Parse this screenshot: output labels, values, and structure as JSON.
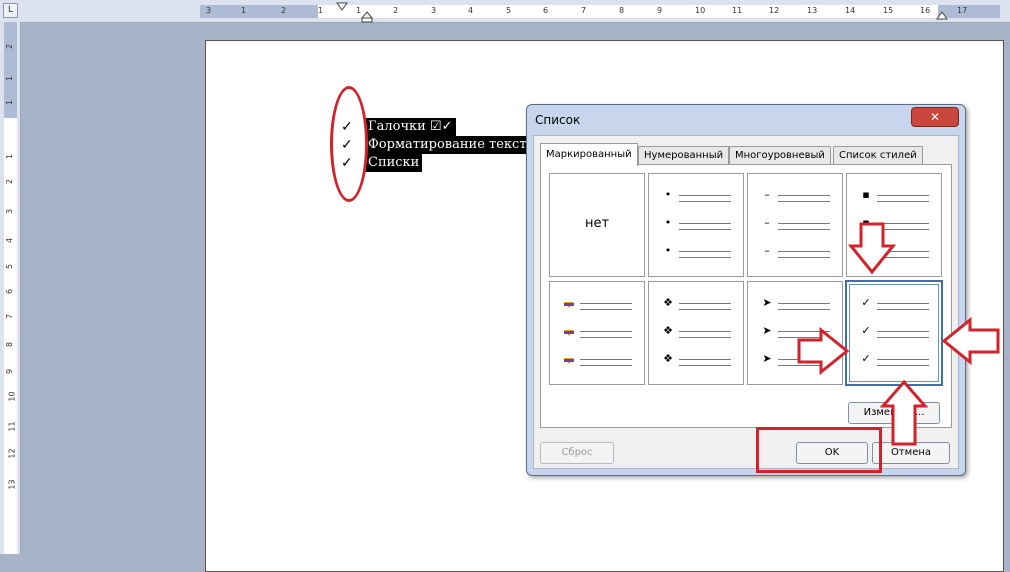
{
  "ruler": {
    "horizontal_ticks": [
      "3",
      "1",
      "2",
      "1",
      "1",
      "2",
      "3",
      "4",
      "5",
      "6",
      "7",
      "8",
      "9",
      "10",
      "11",
      "12",
      "13",
      "14",
      "15",
      "16",
      "17"
    ],
    "vertical_ticks": [
      "2",
      "1",
      "1",
      "1",
      "2",
      "3",
      "4",
      "5",
      "6",
      "7",
      "8",
      "9",
      "10",
      "11",
      "12",
      "13"
    ],
    "corner_label": "L"
  },
  "document": {
    "lines": [
      {
        "bullet": "✓",
        "text": "Галочки ☑✓"
      },
      {
        "bullet": "✓",
        "text": "Форматирование текст"
      },
      {
        "bullet": "✓",
        "text": "Списки"
      }
    ]
  },
  "dialog": {
    "title": "Список",
    "close_label": "✕",
    "tabs": [
      {
        "label": "Маркированный",
        "active": true
      },
      {
        "label": "Нумерованный",
        "active": false
      },
      {
        "label": "Многоуровневый",
        "active": false
      },
      {
        "label": "Список стилей",
        "active": false
      }
    ],
    "none_label": "нет",
    "bullet_styles": [
      "none",
      "•",
      "–",
      "▪",
      "arrow-bullet-icon",
      "❖",
      "➤",
      "✓"
    ],
    "selected_style_index": 7,
    "modify_label": "Изменить...",
    "reset_label": "Сброс",
    "ok_label": "OK",
    "cancel_label": "Отмена"
  },
  "colors": {
    "annotation_red": "#d2232a",
    "dialog_frame": "#c7d6ec",
    "selection_blue": "#3b6fb0"
  }
}
